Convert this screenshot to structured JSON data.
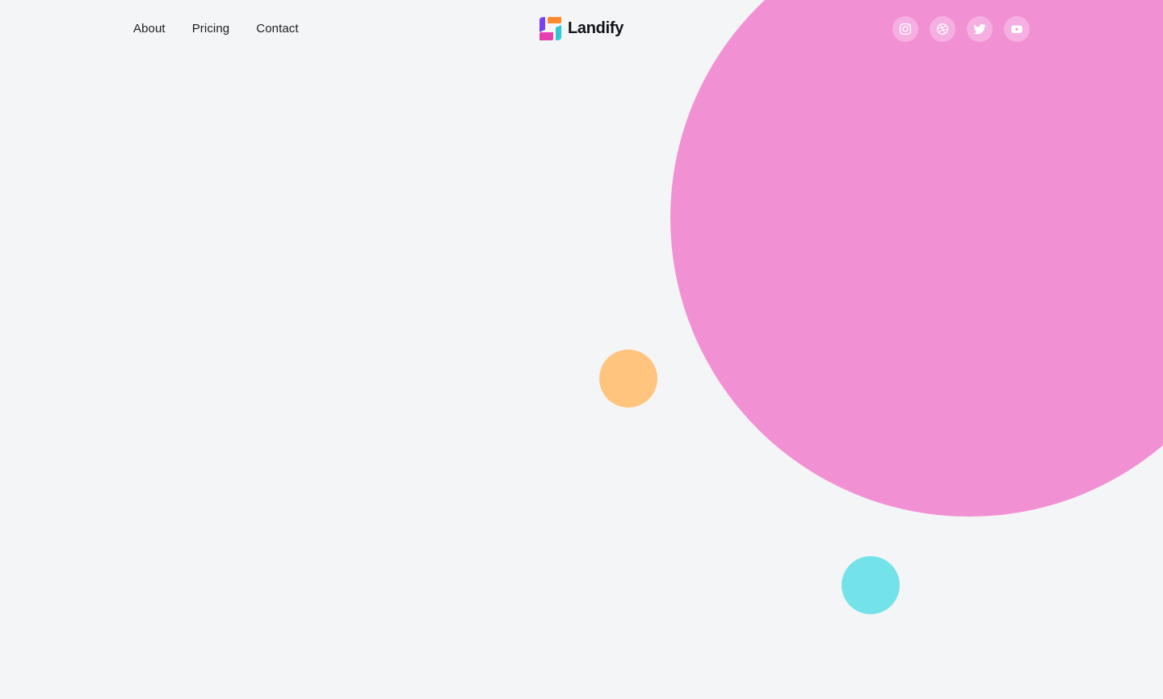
{
  "nav": {
    "items": [
      {
        "label": "About"
      },
      {
        "label": "Pricing"
      },
      {
        "label": "Contact"
      }
    ]
  },
  "brand": {
    "name": "Landify",
    "logo_colors": [
      "#7b3ff2",
      "#ff8a2b",
      "#e83fae",
      "#2fc6d6"
    ]
  },
  "socials": [
    {
      "icon": "instagram-icon"
    },
    {
      "icon": "dribbble-icon"
    },
    {
      "icon": "twitter-icon"
    },
    {
      "icon": "youtube-icon"
    }
  ],
  "colors": {
    "background": "#f4f5f7",
    "pink": "#f290d4",
    "orange": "#ffc47d",
    "cyan": "#74e3e9",
    "text": "#1c1d22"
  }
}
